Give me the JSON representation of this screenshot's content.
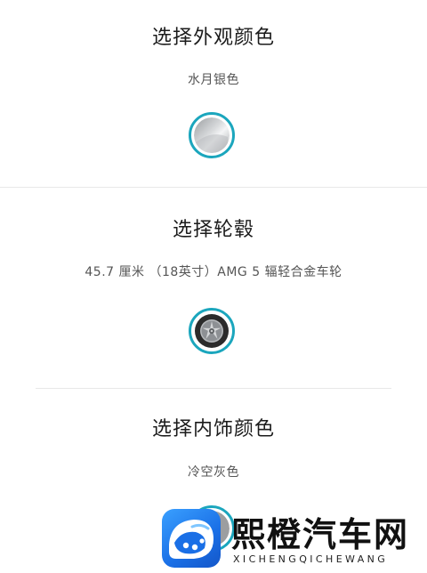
{
  "exterior": {
    "title": "选择外观颜色",
    "selected": "水月银色",
    "swatch_icon": "silver-paint-swatch"
  },
  "wheels": {
    "title": "选择轮毂",
    "selected": "45.7 厘米 （18英寸）AMG 5 辐轻合金车轮",
    "swatch_icon": "wheel-swatch"
  },
  "interior": {
    "title": "选择内饰颜色",
    "selected": "冷空灰色",
    "swatch_icon": "grey-interior-swatch"
  },
  "watermark": {
    "name": "熙橙汽车网",
    "pinyin": "XICHENGQICHEWANG",
    "brand_color": "#1a6fe6"
  },
  "colors": {
    "accent_ring": "#1ba6bd",
    "text_primary": "#1c1c1c",
    "text_secondary": "#555555",
    "divider": "#e8e8e8"
  }
}
